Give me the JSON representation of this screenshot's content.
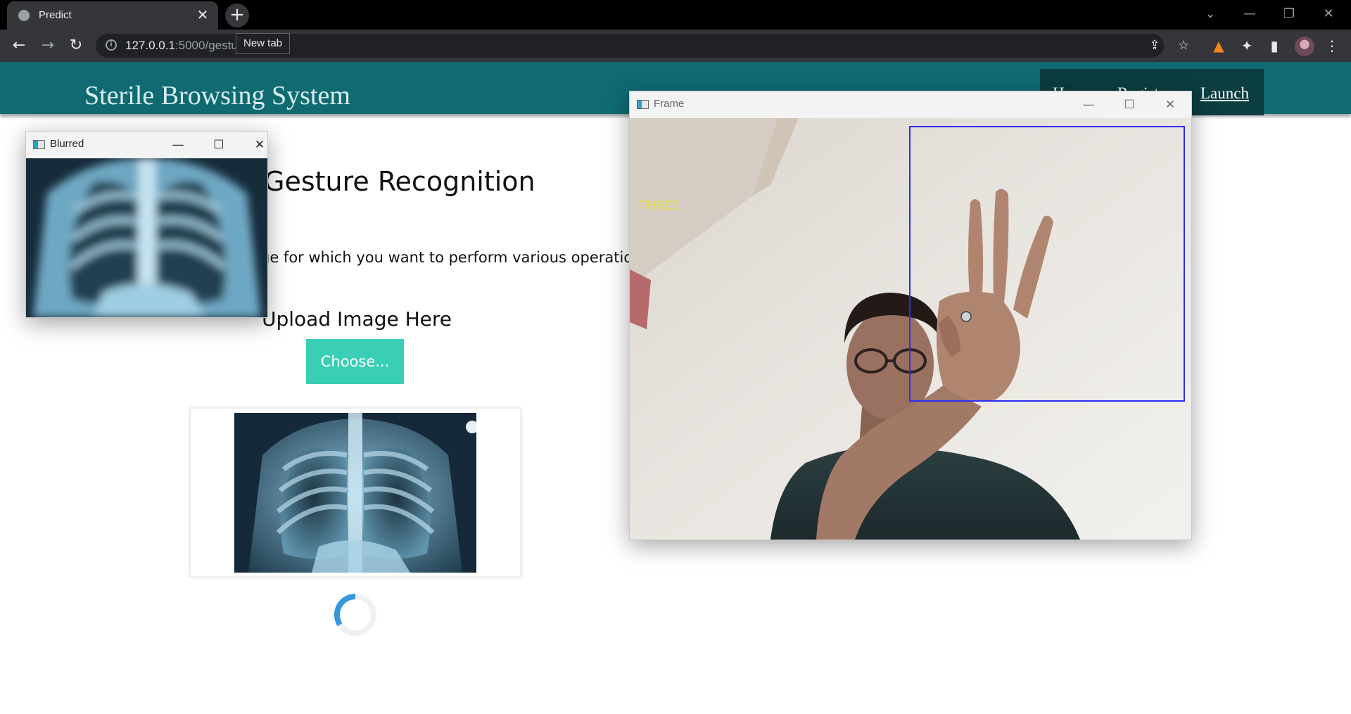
{
  "browser": {
    "tab_title": "Predict",
    "tab_close": "✕",
    "new_tab_symbol": "+",
    "tooltip": "New tab",
    "url_host": "127.0.0.1",
    "url_rest": ":5000/gestu"
  },
  "header": {
    "brand": "Sterile Browsing System",
    "nav": [
      "Ho",
      "Regist",
      "Launch"
    ]
  },
  "main": {
    "title": "Gesture Recognition",
    "description": "ge for which you want to perform various operations",
    "upload_title": "Upload Image Here",
    "choose_button": "Choose..."
  },
  "windows": {
    "blurred": {
      "title": "Blurred"
    },
    "frame": {
      "title": "Frame",
      "gesture_label": "THREE"
    }
  },
  "colors": {
    "header_bg": "#0f6a71",
    "nav_bg": "#0b3d41",
    "choose_bg": "#3acfb5",
    "gesture_text": "#e8e23a",
    "roi_box": "#2d2df0",
    "spinner": "#3498db"
  },
  "icons": [
    "globe-icon",
    "close-icon",
    "plus-icon",
    "back-icon",
    "forward-icon",
    "reload-icon",
    "info-icon",
    "share-icon",
    "star-icon",
    "fox-icon",
    "puzzle-icon",
    "sidepanel-icon",
    "menu-icon",
    "minimize-icon",
    "maximize-icon",
    "spinner-icon"
  ]
}
